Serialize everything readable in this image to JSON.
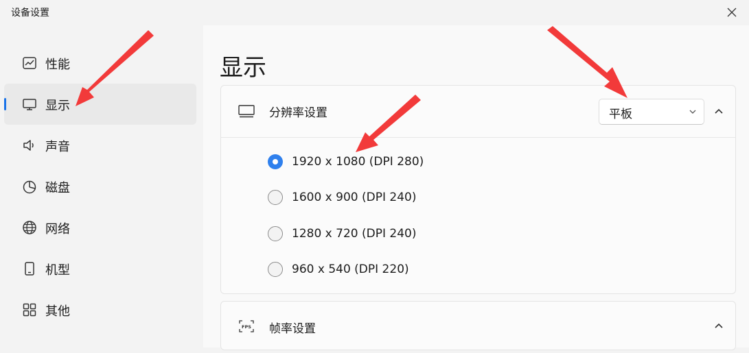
{
  "window": {
    "title": "设备设置"
  },
  "sidebar": {
    "items": [
      {
        "label": "性能",
        "icon": "chart-line-icon",
        "selected": false
      },
      {
        "label": "显示",
        "icon": "monitor-icon",
        "selected": true
      },
      {
        "label": "声音",
        "icon": "speaker-icon",
        "selected": false
      },
      {
        "label": "磁盘",
        "icon": "pie-chart-icon",
        "selected": false
      },
      {
        "label": "网络",
        "icon": "globe-icon",
        "selected": false
      },
      {
        "label": "机型",
        "icon": "phone-icon",
        "selected": false
      },
      {
        "label": "其他",
        "icon": "grid-icon",
        "selected": false
      }
    ]
  },
  "main": {
    "page_title": "显示",
    "resolution": {
      "label": "分辨率设置",
      "device_type": "平板",
      "options": [
        {
          "label": "1920 x 1080 (DPI 280)",
          "checked": true
        },
        {
          "label": "1600 x 900 (DPI 240)",
          "checked": false
        },
        {
          "label": "1280 x 720 (DPI 240)",
          "checked": false
        },
        {
          "label": "960 x 540 (DPI 220)",
          "checked": false
        }
      ]
    },
    "fps": {
      "label": "帧率设置",
      "icon_text": "FPS"
    }
  },
  "colors": {
    "accent": "#2f80ed",
    "annotation_arrow": "#f23a3a"
  }
}
